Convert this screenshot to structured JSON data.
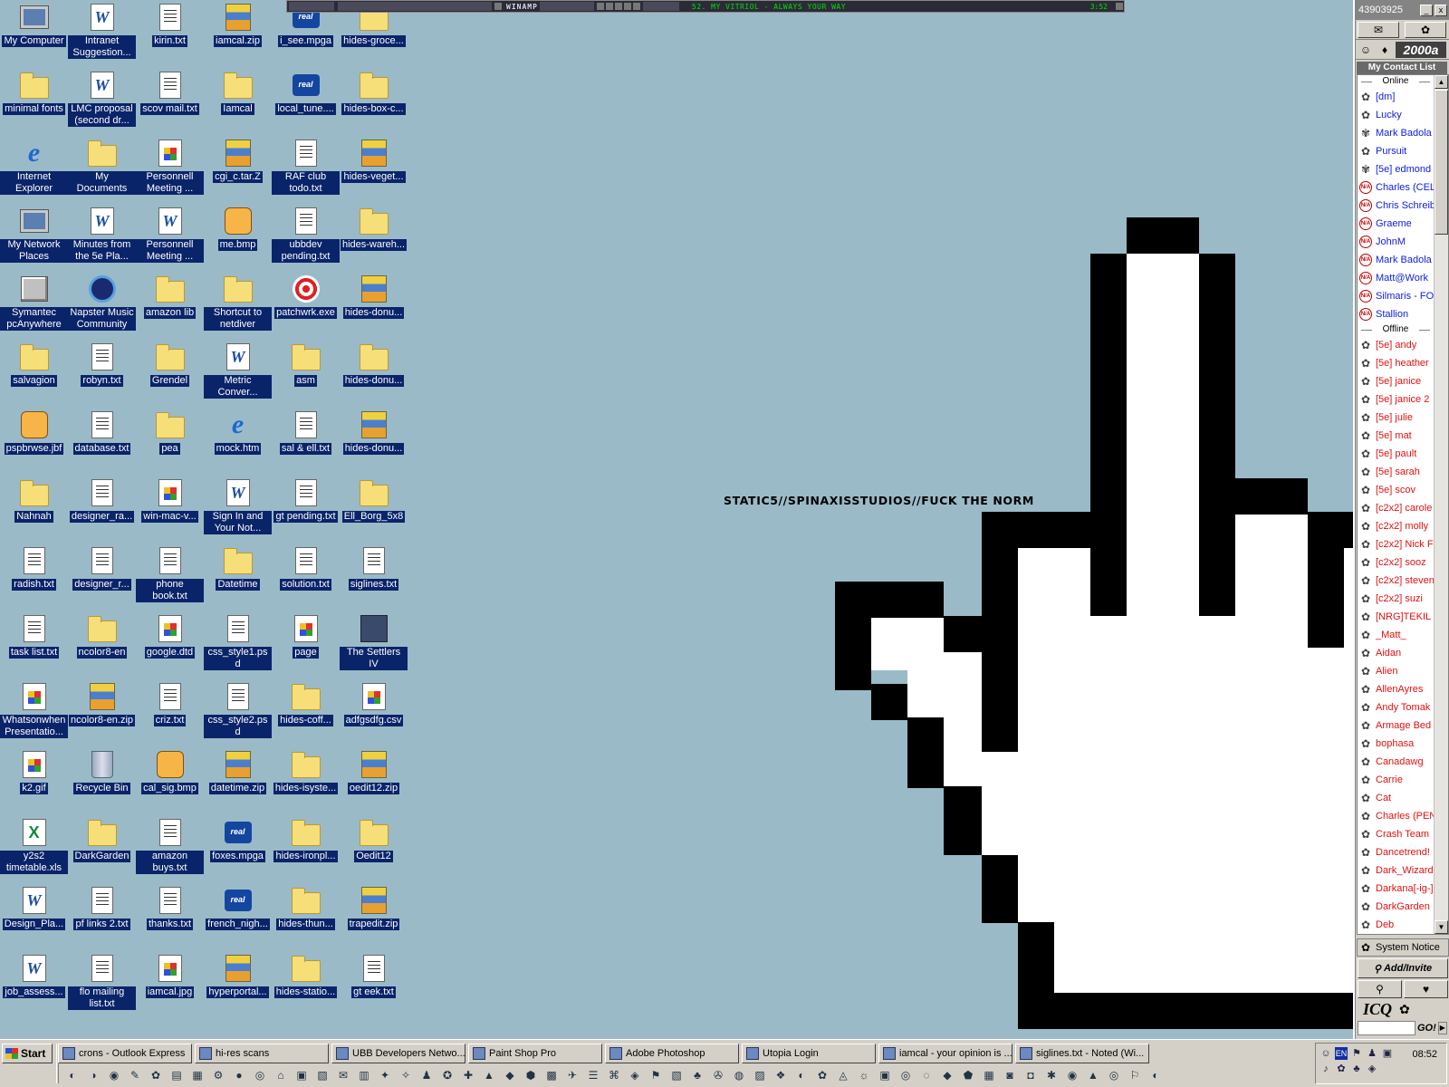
{
  "desktop": {
    "icons": [
      {
        "label": "My Computer",
        "kind": "pc"
      },
      {
        "label": "minimal fonts",
        "kind": "folder"
      },
      {
        "label": "Internet Explorer",
        "kind": "ie"
      },
      {
        "label": "My Network Places",
        "kind": "pc"
      },
      {
        "label": "Symantec pcAnywhere",
        "kind": "app"
      },
      {
        "label": "salvagion",
        "kind": "folder"
      },
      {
        "label": "pspbrwse.jbf",
        "kind": "paint"
      },
      {
        "label": "Nahnah",
        "kind": "folder"
      },
      {
        "label": "radish.txt",
        "kind": "txt"
      },
      {
        "label": "task list.txt",
        "kind": "txt"
      },
      {
        "label": "Whatsonwhen Presentatio...",
        "kind": "img"
      },
      {
        "label": "k2.gif",
        "kind": "img"
      },
      {
        "label": "y2s2 timetable.xls",
        "kind": "xls"
      },
      {
        "label": "Design_Pla...",
        "kind": "word"
      },
      {
        "label": "job_assess...",
        "kind": "word"
      },
      {
        "label": "Intranet Suggestion...",
        "kind": "word"
      },
      {
        "label": "LMC proposal (second dr...",
        "kind": "word"
      },
      {
        "label": "My Documents",
        "kind": "folder"
      },
      {
        "label": "Minutes from the 5e Pla...",
        "kind": "word"
      },
      {
        "label": "Napster Music Community",
        "kind": "napster"
      },
      {
        "label": "robyn.txt",
        "kind": "txt"
      },
      {
        "label": "database.txt",
        "kind": "txt"
      },
      {
        "label": "designer_ra...",
        "kind": "txt"
      },
      {
        "label": "designer_r...",
        "kind": "txt"
      },
      {
        "label": "ncolor8-en",
        "kind": "folder"
      },
      {
        "label": "ncolor8-en.zip",
        "kind": "zip"
      },
      {
        "label": "Recycle Bin",
        "kind": "bin"
      },
      {
        "label": "DarkGarden",
        "kind": "folder"
      },
      {
        "label": "pf links 2.txt",
        "kind": "txt"
      },
      {
        "label": "flo mailing list.txt",
        "kind": "txt"
      },
      {
        "label": "kirin.txt",
        "kind": "txt"
      },
      {
        "label": "scov mail.txt",
        "kind": "txt"
      },
      {
        "label": "Personnell Meeting ...",
        "kind": "img"
      },
      {
        "label": "Personnell Meeting ...",
        "kind": "word"
      },
      {
        "label": "amazon lib",
        "kind": "folder"
      },
      {
        "label": "Grendel",
        "kind": "folder"
      },
      {
        "label": "pea",
        "kind": "folder"
      },
      {
        "label": "win-mac-v...",
        "kind": "img"
      },
      {
        "label": "phone book.txt",
        "kind": "txt"
      },
      {
        "label": "google.dtd",
        "kind": "img"
      },
      {
        "label": "criz.txt",
        "kind": "txt"
      },
      {
        "label": "cal_sig.bmp",
        "kind": "paint"
      },
      {
        "label": "amazon buys.txt",
        "kind": "txt"
      },
      {
        "label": "thanks.txt",
        "kind": "txt"
      },
      {
        "label": "iamcal.jpg",
        "kind": "img"
      },
      {
        "label": "iamcal.zip",
        "kind": "zip"
      },
      {
        "label": "Iamcal",
        "kind": "folder"
      },
      {
        "label": "cgi_c.tar.Z",
        "kind": "zip"
      },
      {
        "label": "me.bmp",
        "kind": "paint"
      },
      {
        "label": "Shortcut to netdiver",
        "kind": "folder"
      },
      {
        "label": "Metric Conver...",
        "kind": "word"
      },
      {
        "label": "mock.htm",
        "kind": "ie"
      },
      {
        "label": "Sign In and Your Not...",
        "kind": "word"
      },
      {
        "label": "Datetime",
        "kind": "folder"
      },
      {
        "label": "css_style1.psd",
        "kind": "txt"
      },
      {
        "label": "css_style2.psd",
        "kind": "txt"
      },
      {
        "label": "datetime.zip",
        "kind": "zip"
      },
      {
        "label": "foxes.mpga",
        "kind": "real"
      },
      {
        "label": "french_nigh...",
        "kind": "real"
      },
      {
        "label": "hyperportal...",
        "kind": "zip"
      },
      {
        "label": "i_see.mpga",
        "kind": "real"
      },
      {
        "label": "local_tune....",
        "kind": "real"
      },
      {
        "label": "RAF club todo.txt",
        "kind": "txt"
      },
      {
        "label": "ubbdev pending.txt",
        "kind": "txt"
      },
      {
        "label": "patchwrk.exe",
        "kind": "target"
      },
      {
        "label": "asm",
        "kind": "folder"
      },
      {
        "label": "sal & ell.txt",
        "kind": "txt"
      },
      {
        "label": "gt pending.txt",
        "kind": "txt"
      },
      {
        "label": "solution.txt",
        "kind": "txt"
      },
      {
        "label": "page",
        "kind": "img"
      },
      {
        "label": "hides-coff...",
        "kind": "folder"
      },
      {
        "label": "hides-isyste...",
        "kind": "folder"
      },
      {
        "label": "hides-ironpl...",
        "kind": "folder"
      },
      {
        "label": "hides-thun...",
        "kind": "folder"
      },
      {
        "label": "hides-statio...",
        "kind": "folder"
      },
      {
        "label": "hides-groce...",
        "kind": "folder"
      },
      {
        "label": "hides-box-c...",
        "kind": "folder"
      },
      {
        "label": "hides-veget...",
        "kind": "zip"
      },
      {
        "label": "hides-wareh...",
        "kind": "folder"
      },
      {
        "label": "hides-donu...",
        "kind": "zip"
      },
      {
        "label": "hides-donu...",
        "kind": "folder"
      },
      {
        "label": "hides-donu...",
        "kind": "zip"
      },
      {
        "label": "Ell_Borg_5x8",
        "kind": "folder"
      },
      {
        "label": "siglines.txt",
        "kind": "txt"
      },
      {
        "label": "The Settlers IV",
        "kind": "settlers"
      },
      {
        "label": "adfgsdfg.csv",
        "kind": "img"
      },
      {
        "label": "oedit12.zip",
        "kind": "zip"
      },
      {
        "label": "Oedit12",
        "kind": "folder"
      },
      {
        "label": "trapedit.zip",
        "kind": "zip"
      },
      {
        "label": "gt eek.txt",
        "kind": "txt"
      }
    ]
  },
  "winamp": {
    "brand": "WINAMP",
    "song": "52. MY VITRIOL - ALWAYS YOUR WAY",
    "time": "3:52"
  },
  "wallpaper": {
    "text": "STATIC5//SPINAXISSTUDIOS//FUCK THE NORM"
  },
  "icq": {
    "uin": "43903925",
    "version": "2000a",
    "list_title": "My Contact List",
    "online_label": "Online",
    "offline_label": "Offline",
    "online": [
      {
        "name": "[dm]",
        "status": "online"
      },
      {
        "name": "Lucky",
        "status": "online"
      },
      {
        "name": "Mark Badola",
        "status": "away"
      },
      {
        "name": "Pursuit",
        "status": "online"
      },
      {
        "name": "[5e] edmond",
        "status": "away"
      },
      {
        "name": "Charles (CEL",
        "status": "na"
      },
      {
        "name": "Chris Schreib",
        "status": "na"
      },
      {
        "name": "Graeme",
        "status": "na"
      },
      {
        "name": "JohnM",
        "status": "na"
      },
      {
        "name": "Mark Badola",
        "status": "na"
      },
      {
        "name": "Matt@Work",
        "status": "na"
      },
      {
        "name": "Silmaris - FOI",
        "status": "na"
      },
      {
        "name": "Stallion",
        "status": "na"
      }
    ],
    "offline": [
      "[5e] andy",
      "[5e] heather",
      "[5e] janice",
      "[5e] janice 2",
      "[5e] julie",
      "[5e] mat",
      "[5e] pault",
      "[5e] sarah",
      "[5e] scov",
      "[c2x2] carole",
      "[c2x2] molly",
      "[c2x2] Nick F",
      "[c2x2] sooz",
      "[c2x2] steven",
      "[c2x2] suzi",
      "[NRG]TEKIL",
      "_Matt_",
      "Aidan",
      "Alien",
      "AllenAyres",
      "Andy Tomak",
      "Armage Bed",
      "bophasa",
      "Canadawg",
      "Carrie",
      "Cat",
      "Charles (PEN",
      "Crash Team",
      "Dancetrend!",
      "Dark_Wizard",
      "Darkana[-ig-]",
      "DarkGarden",
      "Deb"
    ],
    "system_notice": "System Notice",
    "add_invite": "Add/Invite",
    "logo": "ICQ",
    "go": "GO!"
  },
  "taskbar": {
    "start": "Start",
    "tasks": [
      "crons - Outlook Express",
      "hi-res scans",
      "UBB Developers Netwo...",
      "Paint Shop Pro",
      "Adobe Photoshop",
      "Utopia Login",
      "iamcal - your opinion is ...",
      "siglines.txt - Noted (Wi..."
    ],
    "clock": "08:52",
    "lang": "EN"
  }
}
